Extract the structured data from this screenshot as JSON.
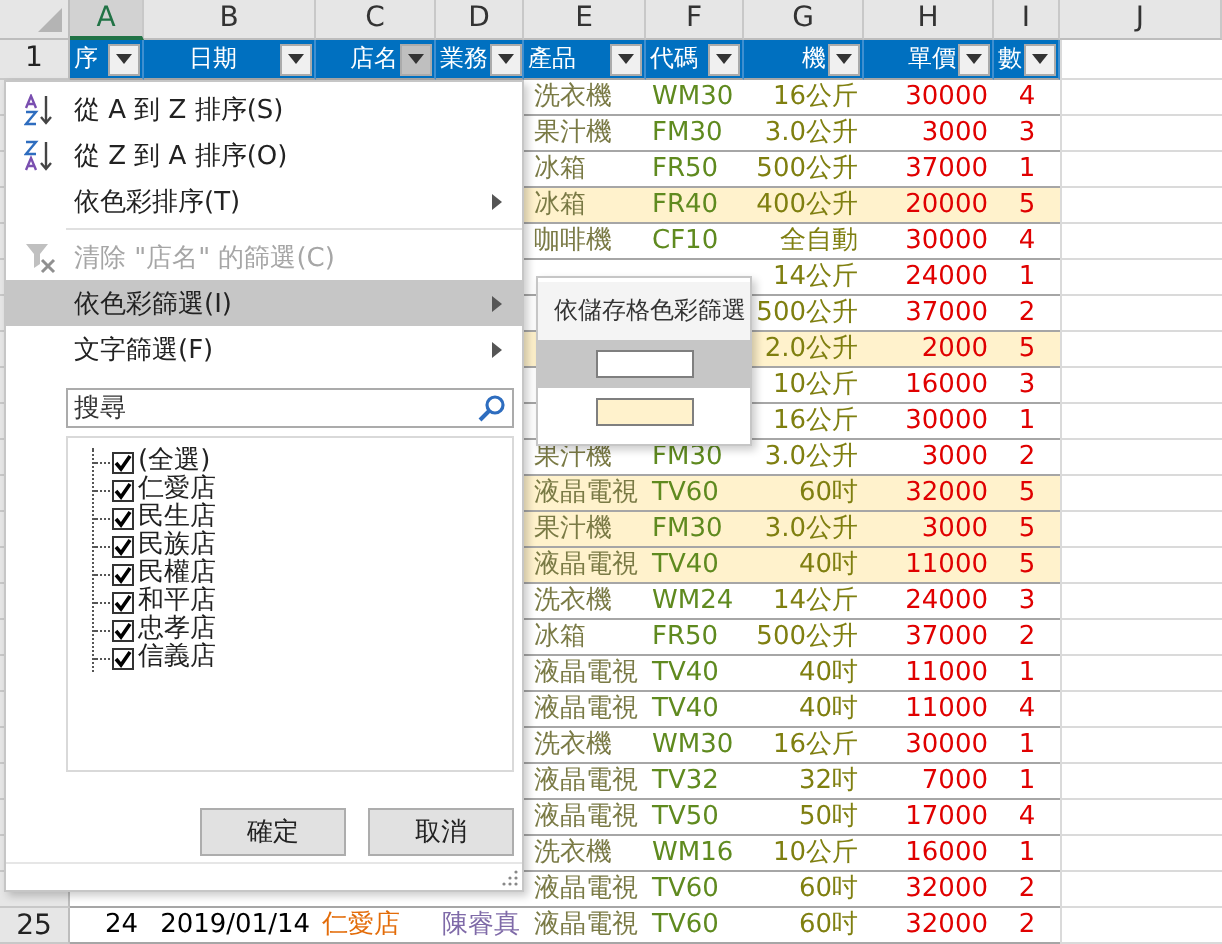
{
  "column_headers": [
    {
      "letter": "A",
      "selected": true
    },
    {
      "letter": "B",
      "selected": false
    },
    {
      "letter": "C",
      "selected": false
    },
    {
      "letter": "D",
      "selected": false
    },
    {
      "letter": "E",
      "selected": false
    },
    {
      "letter": "F",
      "selected": false
    },
    {
      "letter": "G",
      "selected": false
    },
    {
      "letter": "H",
      "selected": false
    },
    {
      "letter": "I",
      "selected": false
    },
    {
      "letter": "J",
      "selected": false
    }
  ],
  "header_row": {
    "number": "1",
    "fields": [
      {
        "label": "序",
        "filter_pressed": false
      },
      {
        "label": "日期",
        "filter_pressed": false
      },
      {
        "label": "店名",
        "filter_pressed": true
      },
      {
        "label": "業務",
        "filter_pressed": false
      },
      {
        "label": "產品",
        "filter_pressed": false
      },
      {
        "label": "代碼",
        "filter_pressed": false
      },
      {
        "label": "機",
        "filter_pressed": false
      },
      {
        "label": "單價",
        "filter_pressed": false
      },
      {
        "label": "數",
        "filter_pressed": false
      }
    ]
  },
  "rows": [
    {
      "highlighted": false,
      "col_e": "洗衣機",
      "col_f": "WM30",
      "col_g": "16公斤",
      "col_h": "30000",
      "col_i": "4"
    },
    {
      "highlighted": false,
      "col_e": "果汁機",
      "col_f": "FM30",
      "col_g": "3.0公升",
      "col_h": "3000",
      "col_i": "3"
    },
    {
      "highlighted": false,
      "col_e": "冰箱",
      "col_f": "FR50",
      "col_g": "500公升",
      "col_h": "37000",
      "col_i": "1"
    },
    {
      "highlighted": true,
      "col_e": "冰箱",
      "col_f": "FR40",
      "col_g": "400公升",
      "col_h": "20000",
      "col_i": "5"
    },
    {
      "highlighted": false,
      "col_e": "咖啡機",
      "col_f": "CF10",
      "col_g": "全自動",
      "col_h": "30000",
      "col_i": "4"
    },
    {
      "highlighted": false,
      "col_g": "14公斤",
      "col_h": "24000",
      "col_i": "1"
    },
    {
      "highlighted": false,
      "col_g": "500公升",
      "col_h": "37000",
      "col_i": "2"
    },
    {
      "highlighted": true,
      "col_g": "2.0公升",
      "col_h": "2000",
      "col_i": "5"
    },
    {
      "highlighted": false,
      "col_g": "10公斤",
      "col_h": "16000",
      "col_i": "3"
    },
    {
      "highlighted": false,
      "col_g": "16公斤",
      "col_h": "30000",
      "col_i": "1"
    },
    {
      "highlighted": false,
      "col_e": "果汁機",
      "col_f": "FM30",
      "col_g": "3.0公升",
      "col_h": "3000",
      "col_i": "2"
    },
    {
      "highlighted": true,
      "col_e": "液晶電視",
      "col_f": "TV60",
      "col_g": "60吋",
      "col_h": "32000",
      "col_i": "5"
    },
    {
      "highlighted": true,
      "col_e": "果汁機",
      "col_f": "FM30",
      "col_g": "3.0公升",
      "col_h": "3000",
      "col_i": "5"
    },
    {
      "highlighted": true,
      "col_e": "液晶電視",
      "col_f": "TV40",
      "col_g": "40吋",
      "col_h": "11000",
      "col_i": "5"
    },
    {
      "highlighted": false,
      "col_e": "洗衣機",
      "col_f": "WM24",
      "col_g": "14公斤",
      "col_h": "24000",
      "col_i": "3"
    },
    {
      "highlighted": false,
      "col_e": "冰箱",
      "col_f": "FR50",
      "col_g": "500公升",
      "col_h": "37000",
      "col_i": "2"
    },
    {
      "highlighted": false,
      "col_e": "液晶電視",
      "col_f": "TV40",
      "col_g": "40吋",
      "col_h": "11000",
      "col_i": "1"
    },
    {
      "highlighted": false,
      "col_e": "液晶電視",
      "col_f": "TV40",
      "col_g": "40吋",
      "col_h": "11000",
      "col_i": "4"
    },
    {
      "highlighted": false,
      "col_e": "洗衣機",
      "col_f": "WM30",
      "col_g": "16公斤",
      "col_h": "30000",
      "col_i": "1"
    },
    {
      "highlighted": false,
      "col_e": "液晶電視",
      "col_f": "TV32",
      "col_g": "32吋",
      "col_h": "7000",
      "col_i": "1"
    },
    {
      "highlighted": false,
      "col_e": "液晶電視",
      "col_f": "TV50",
      "col_g": "50吋",
      "col_h": "17000",
      "col_i": "4"
    },
    {
      "highlighted": false,
      "col_e": "洗衣機",
      "col_f": "WM16",
      "col_g": "10公斤",
      "col_h": "16000",
      "col_i": "1"
    },
    {
      "highlighted": false,
      "col_e": "液晶電視",
      "col_f": "TV60",
      "col_g": "60吋",
      "col_h": "32000",
      "col_i": "2"
    },
    {
      "number": "25",
      "highlighted": false,
      "col_a": "24",
      "col_b": "2019/01/14",
      "col_c": "仁愛店",
      "col_d": "陳睿真",
      "col_e": "液晶電視",
      "col_f": "TV60",
      "col_g": "60吋",
      "col_h": "32000",
      "col_i": "2"
    }
  ],
  "filter_menu": {
    "items": [
      {
        "kind": "sort-ascending",
        "label": "從 A 到 Z 排序(S)",
        "disabled": false,
        "highlighted": false,
        "submenu": false
      },
      {
        "kind": "sort-descending",
        "label": "從 Z 到 A 排序(O)",
        "disabled": false,
        "highlighted": false,
        "submenu": false
      },
      {
        "kind": "plain",
        "label": "依色彩排序(T)",
        "disabled": false,
        "highlighted": false,
        "submenu": true
      },
      {
        "kind": "separator"
      },
      {
        "kind": "clear-filter",
        "label": "清除 \"店名\" 的篩選(C)",
        "disabled": true,
        "highlighted": false,
        "submenu": false
      },
      {
        "kind": "plain",
        "label": "依色彩篩選(I)",
        "disabled": false,
        "highlighted": true,
        "submenu": true
      },
      {
        "kind": "plain",
        "label": "文字篩選(F)",
        "disabled": false,
        "highlighted": false,
        "submenu": true
      }
    ],
    "search": {
      "placeholder": "搜尋"
    },
    "values": [
      {
        "label": "(全選)",
        "checked": true
      },
      {
        "label": "仁愛店",
        "checked": true
      },
      {
        "label": "民生店",
        "checked": true
      },
      {
        "label": "民族店",
        "checked": true
      },
      {
        "label": "民權店",
        "checked": true
      },
      {
        "label": "和平店",
        "checked": true
      },
      {
        "label": "忠孝店",
        "checked": true
      },
      {
        "label": "信義店",
        "checked": true
      }
    ],
    "buttons": [
      "確定",
      "取消"
    ]
  },
  "color_submenu": {
    "title": "依儲存格色彩篩選",
    "swatches": [
      {
        "color": "#ffffff",
        "highlighted": true
      },
      {
        "color": "#fff2cc",
        "highlighted": false
      }
    ]
  }
}
